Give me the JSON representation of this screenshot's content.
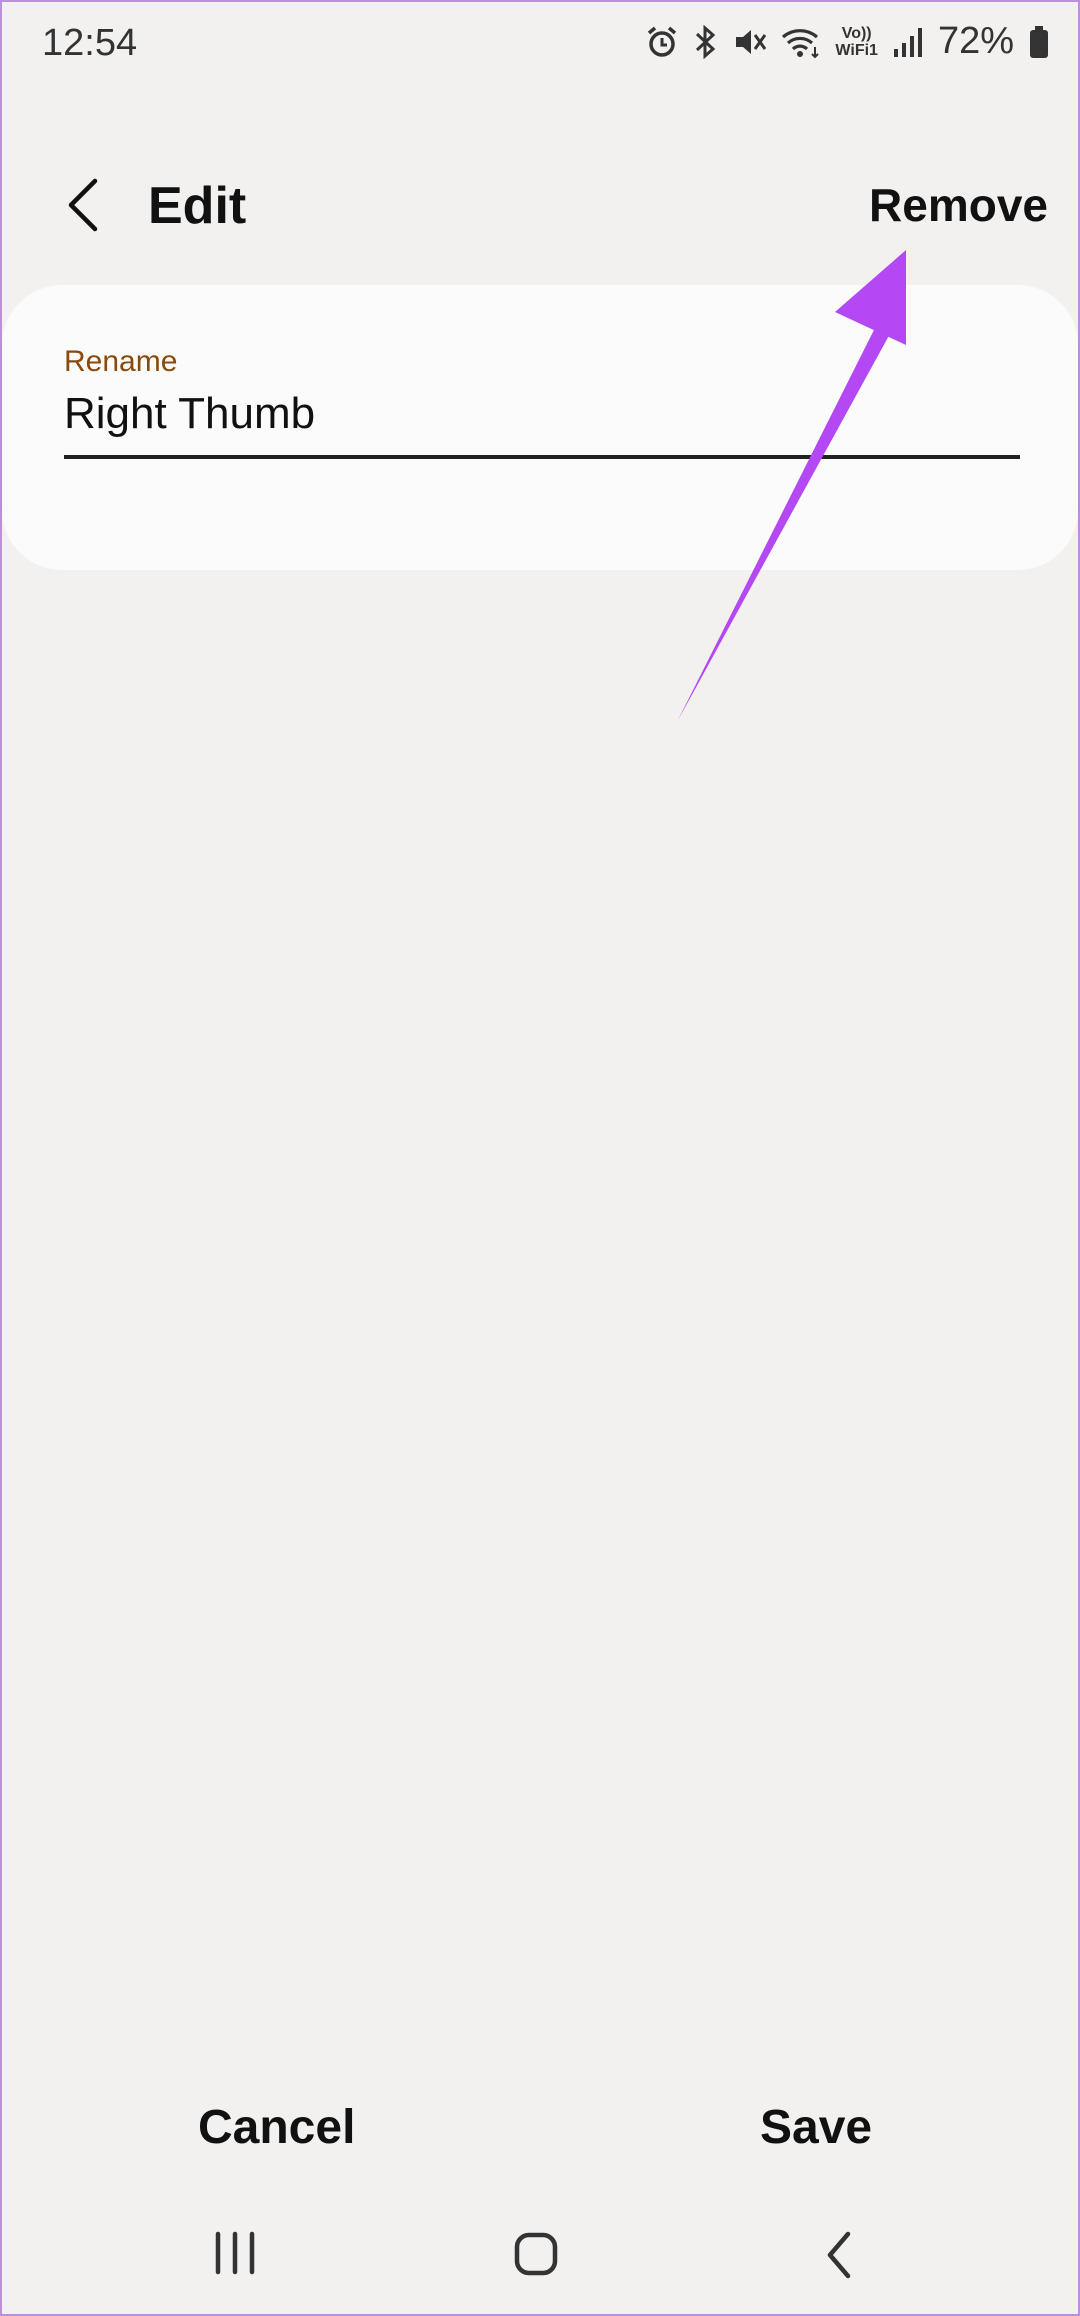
{
  "status_bar": {
    "time": "12:54",
    "volte_line1": "Vo))",
    "volte_line2": "WiFi1",
    "battery_percent": "72%",
    "icons": [
      "alarm-icon",
      "bluetooth-icon",
      "mute-icon",
      "wifi-icon",
      "volte-icon",
      "signal-icon",
      "battery-icon"
    ]
  },
  "app_bar": {
    "title": "Edit",
    "remove_label": "Remove"
  },
  "rename_field": {
    "label": "Rename",
    "value": "Right Thumb"
  },
  "actions": {
    "cancel_label": "Cancel",
    "save_label": "Save"
  },
  "annotation": {
    "color": "#b548f5"
  },
  "colors": {
    "background": "#f2f1f0",
    "card": "#fbfbfb",
    "field_label": "#8a4a0a"
  }
}
